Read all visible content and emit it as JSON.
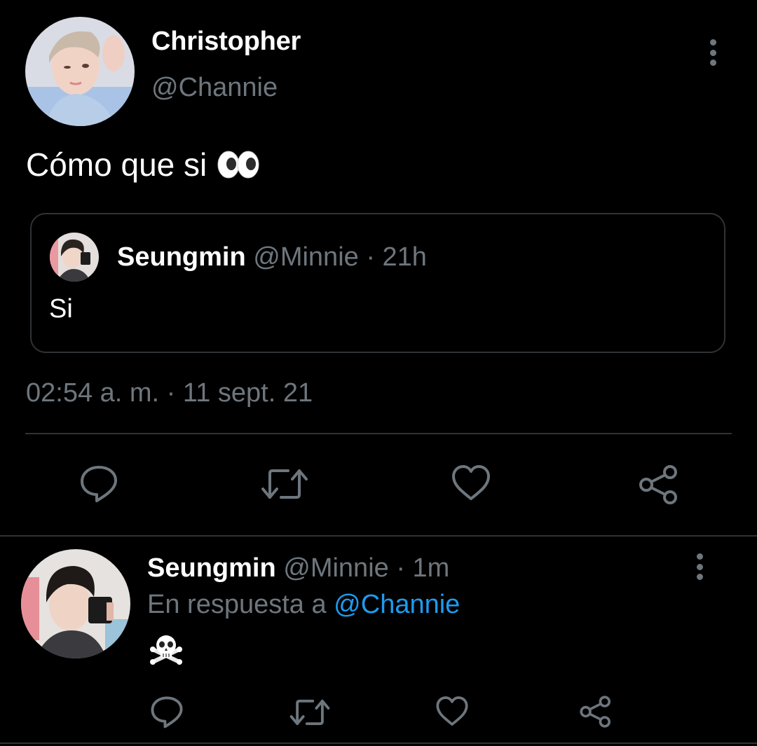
{
  "main_tweet": {
    "display_name": "Christopher",
    "handle": "@Channie",
    "text": "Cómo que si",
    "emoji": "eyes-icon",
    "timestamp": "02:54 a. m. · 11 sept. 21",
    "quoted": {
      "display_name": "Seungmin",
      "meta": "@Minnie · 21h",
      "text": "Si"
    }
  },
  "reply_tweet": {
    "display_name": "Seungmin",
    "meta": "@Minnie · 1m",
    "reply_prefix": "En respuesta a",
    "reply_mention": "@Channie",
    "emoji": "skull-crossbones-icon"
  },
  "colors": {
    "background": "#000000",
    "text_primary": "#ffffff",
    "text_secondary": "#6e767d",
    "accent": "#1d9bf0",
    "divider": "#2f3336"
  }
}
